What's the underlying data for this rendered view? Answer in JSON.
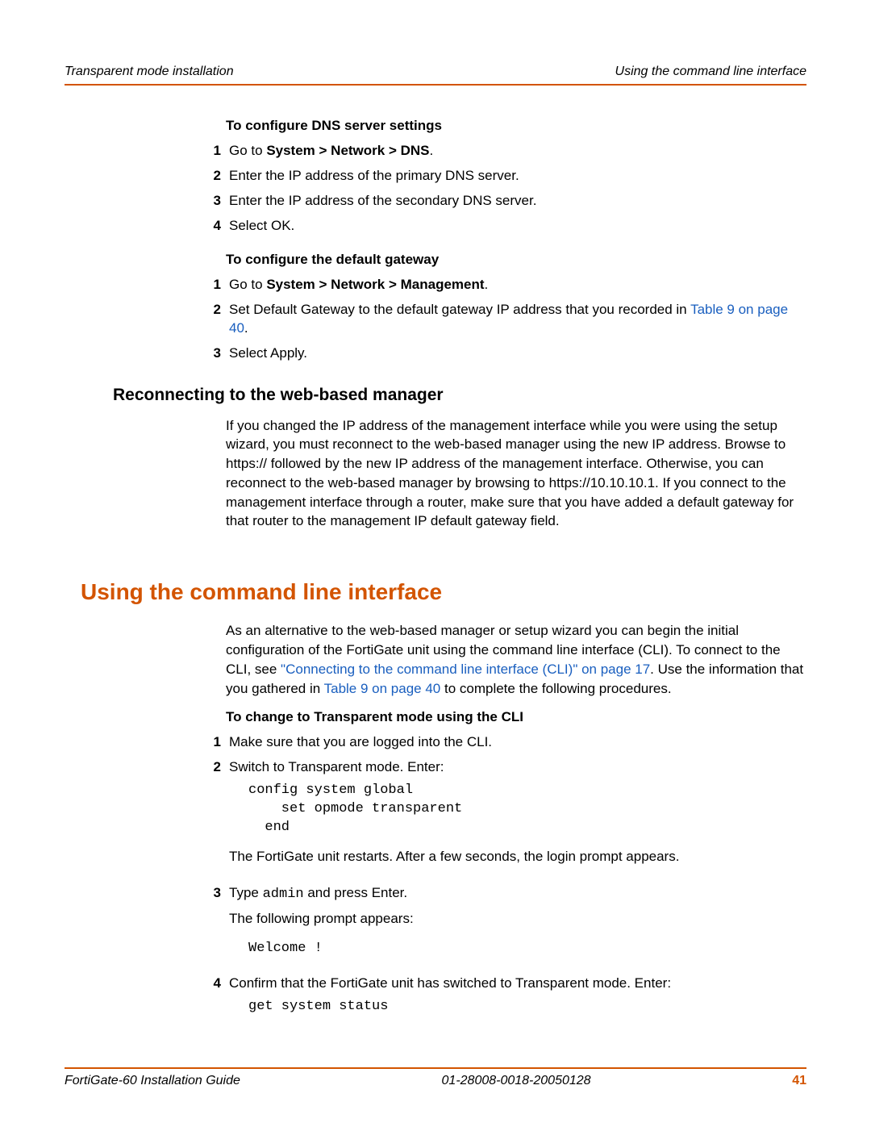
{
  "header": {
    "left": "Transparent mode installation",
    "right": "Using the command line interface"
  },
  "dns": {
    "title": "To configure DNS server settings",
    "steps": {
      "s1_prefix": "Go to ",
      "s1_bold": "System > Network > DNS",
      "s1_suffix": ".",
      "s2": "Enter the IP address of the primary DNS server.",
      "s3": "Enter the IP address of the secondary DNS server.",
      "s4": "Select OK."
    }
  },
  "gateway": {
    "title": "To configure the default gateway",
    "steps": {
      "s1_prefix": "Go to ",
      "s1_bold": "System > Network > Management",
      "s1_suffix": ".",
      "s2_prefix": "Set Default Gateway to the default gateway IP address that you recorded in ",
      "s2_link": "Table 9 on page 40",
      "s2_suffix": ".",
      "s3": "Select Apply."
    }
  },
  "reconnect": {
    "title": "Reconnecting to the web-based manager",
    "para": "If you changed the IP address of the management interface while you were using the setup wizard, you must reconnect to the web-based manager using the new IP address. Browse to https:// followed by the new IP address of the management interface. Otherwise, you can reconnect to the web-based manager by browsing to https://10.10.10.1. If you connect to the management interface through a router, make sure that you have added a default gateway for that router to the management IP default gateway field."
  },
  "cli": {
    "title": "Using the command line interface",
    "intro_prefix": "As an alternative to the web-based manager or setup wizard you can begin the initial configuration of the FortiGate unit using the command line interface (CLI). To connect to the CLI, see ",
    "intro_link1": "\"Connecting to the command line interface (CLI)\" on page 17",
    "intro_mid": ". Use the information that you gathered in ",
    "intro_link2": "Table 9 on page 40",
    "intro_suffix": " to complete the following procedures.",
    "sub_title": "To change to Transparent mode using the CLI",
    "steps": {
      "s1": "Make sure that you are logged into the CLI.",
      "s2": "Switch to Transparent mode. Enter:",
      "code1": "config system global\n    set opmode transparent\n  end",
      "after_code1": "The FortiGate unit restarts. After a few seconds, the login prompt appears.",
      "s3_prefix": "Type ",
      "s3_code": "admin",
      "s3_suffix": " and press Enter.",
      "s3_after": "The following prompt appears:",
      "code2": "Welcome !",
      "s4": "Confirm that the FortiGate unit has switched to Transparent mode. Enter:",
      "code3": "get system status"
    }
  },
  "footer": {
    "left": "FortiGate-60 Installation Guide",
    "center": "01-28008-0018-20050128",
    "page": "41"
  }
}
